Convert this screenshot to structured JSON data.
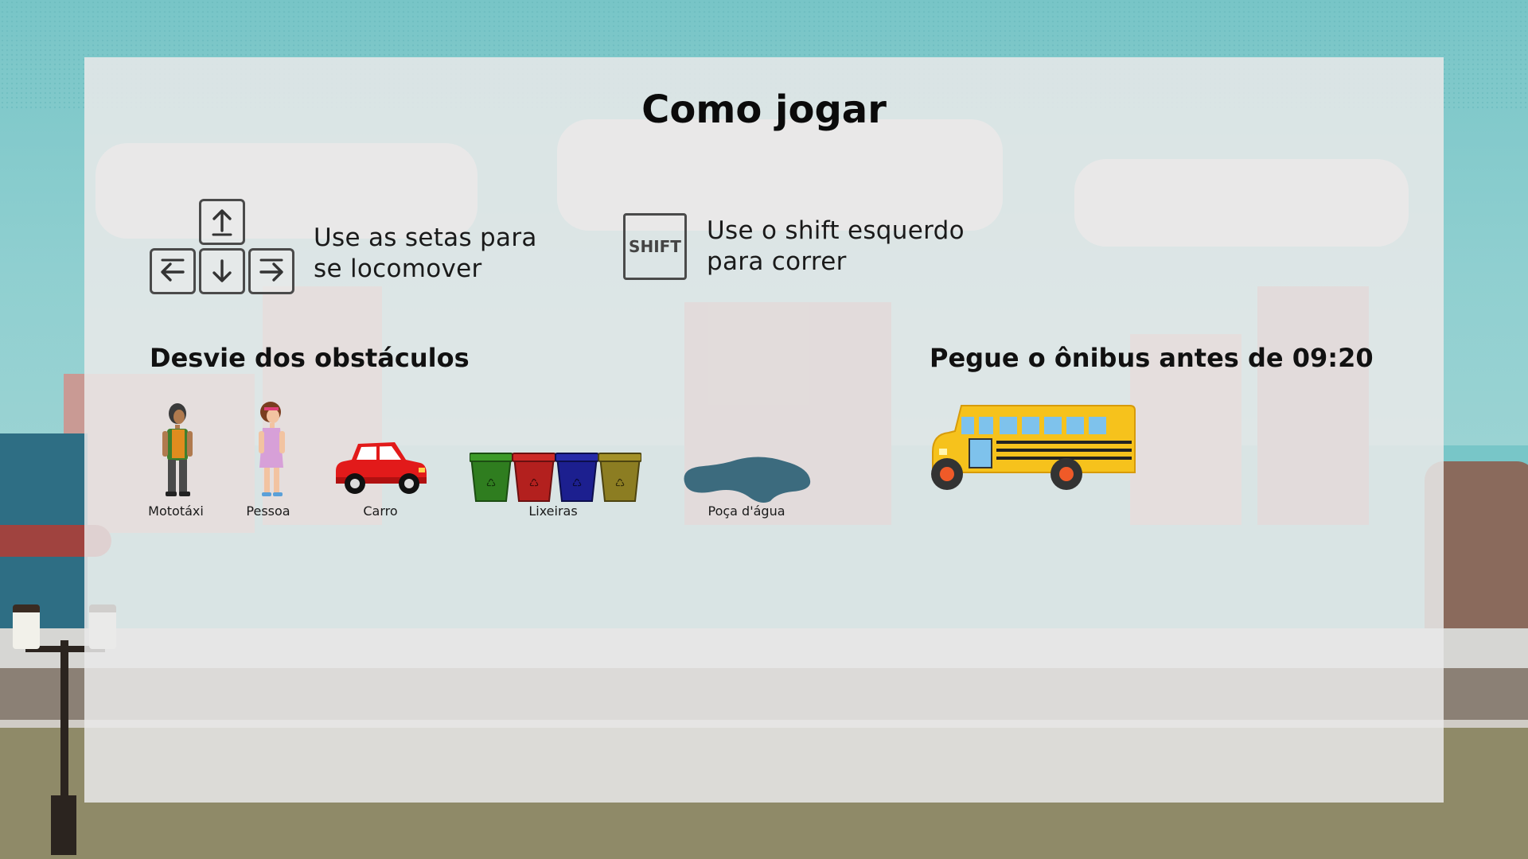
{
  "title": "Como jogar",
  "instructions": {
    "arrows": {
      "line1": "Use as setas para",
      "line2": "se locomover",
      "keys": [
        "arrow-up-key",
        "arrow-left-key",
        "arrow-down-key",
        "arrow-right-key"
      ]
    },
    "shift": {
      "key_label": "SHIFT",
      "line1": "Use o shift esquerdo",
      "line2": "para correr"
    }
  },
  "obstacles": {
    "heading": "Desvie dos obstáculos",
    "items": [
      {
        "label": "Mototáxi",
        "icon": "mototaxi-driver-icon"
      },
      {
        "label": "Pessoa",
        "icon": "pedestrian-girl-icon"
      },
      {
        "label": "Carro",
        "icon": "red-car-icon"
      },
      {
        "label": "Lixeiras",
        "icon": "trash-bins-icon"
      },
      {
        "label": "Poça d'água",
        "icon": "water-puddle-icon"
      }
    ]
  },
  "goal": {
    "heading": "Pegue o ônibus antes de 09:20",
    "icon": "school-bus-icon"
  },
  "colors": {
    "panel": "#e9e9e9",
    "sky": "#78c6c8",
    "bus": "#f6c21c",
    "car": "#e02020",
    "puddle": "#3c6b7e",
    "bins": [
      "#2f7d1f",
      "#b3201e",
      "#1c1f8f",
      "#8c7d22"
    ]
  }
}
